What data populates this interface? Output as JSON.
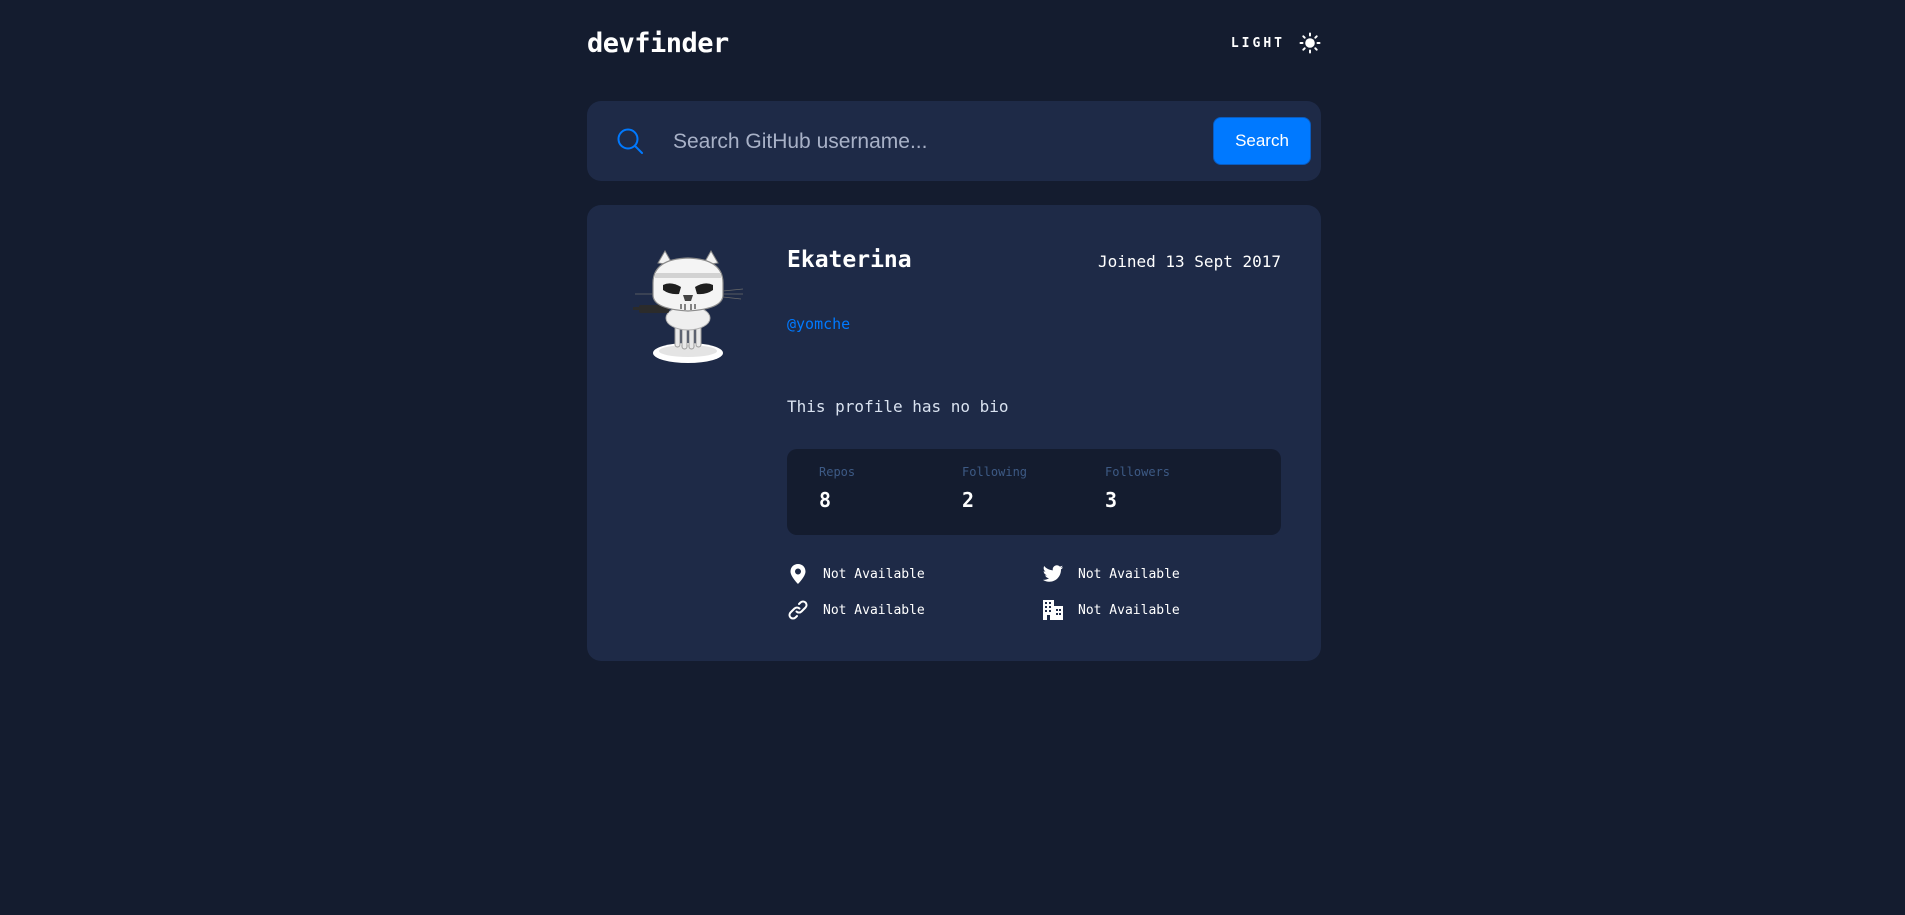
{
  "header": {
    "logo": "devfinder",
    "theme_label": "LIGHT",
    "theme_icon": "sun-icon"
  },
  "search": {
    "icon": "search-icon",
    "placeholder": "Search GitHub username...",
    "value": "",
    "button_label": "Search"
  },
  "profile": {
    "avatar": "octocat-stormtrooper-avatar",
    "name": "Ekaterina",
    "joined": "Joined 13 Sept 2017",
    "handle": "@yomche",
    "bio": "This profile has no bio",
    "stats": [
      {
        "label": "Repos",
        "value": "8"
      },
      {
        "label": "Following",
        "value": "2"
      },
      {
        "label": "Followers",
        "value": "3"
      }
    ],
    "links": {
      "location": {
        "icon": "location-pin-icon",
        "text": "Not Available"
      },
      "twitter": {
        "icon": "twitter-icon",
        "text": "Not Available"
      },
      "website": {
        "icon": "link-icon",
        "text": "Not Available"
      },
      "company": {
        "icon": "building-icon",
        "text": "Not Available"
      }
    }
  },
  "colors": {
    "background": "#141c2f",
    "card": "#1e2a47",
    "accent": "#0079ff",
    "stat_label": "#3d5a85"
  }
}
